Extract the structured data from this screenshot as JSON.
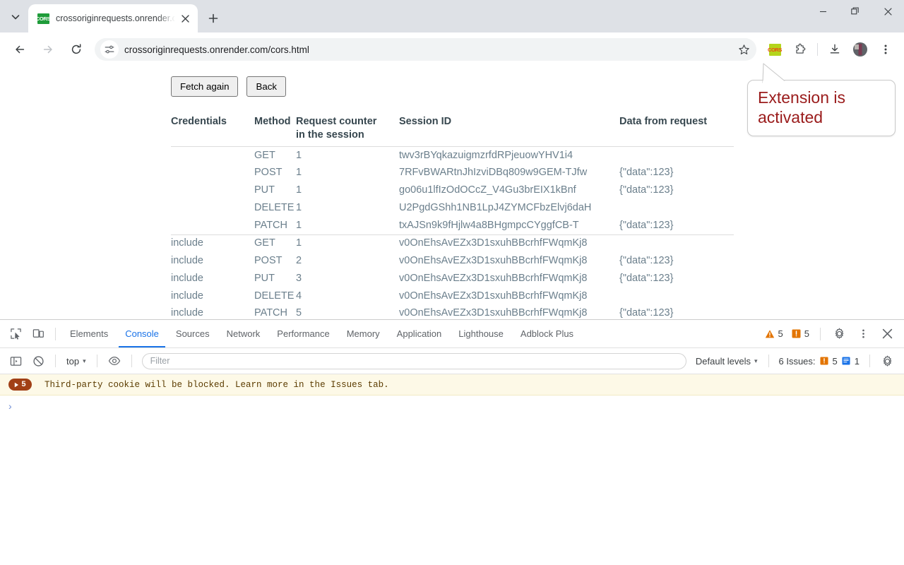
{
  "browser": {
    "tab": {
      "title": "crossoriginrequests.onrender.c",
      "favicon_label": "CORS",
      "favicon_icon": "cors-green-logo",
      "close_icon": "close-icon"
    },
    "tab_search_icon": "chevron-down-icon",
    "new_tab_icon": "plus-icon",
    "window_controls": {
      "minimize_icon": "minimize-icon",
      "maximize_icon": "maximize-restore-icon",
      "close_icon": "close-icon"
    },
    "toolbar": {
      "back_icon": "back-arrow-icon",
      "forward_icon": "forward-arrow-icon",
      "reload_icon": "reload-icon",
      "site_info_icon": "tune-sliders-icon",
      "url": "crossoriginrequests.onrender.com/cors.html",
      "bookmark_icon": "star-icon",
      "extension_cors_label": "CORS",
      "extension_cors_icon": "cors-extension-icon",
      "extensions_puzzle_icon": "puzzle-piece-icon",
      "downloads_icon": "download-icon",
      "profile_icon": "avatar-icon",
      "menu_icon": "three-dots-vertical-icon"
    }
  },
  "callout": {
    "line1": "Extension is",
    "line2": "activated",
    "color": "#9a1b1b"
  },
  "page": {
    "buttons": {
      "fetch_again": "Fetch again",
      "back": "Back"
    },
    "table": {
      "headers": {
        "credentials": "Credentials",
        "method": "Method",
        "counter_line1": "Request counter",
        "counter_line2": "in the session",
        "session_id": "Session ID",
        "data": "Data from request"
      },
      "group1": [
        {
          "credentials": "",
          "method": "GET",
          "counter": "1",
          "session": "twv3rBYqkazuigmzrfdRPjeuowYHV1i4",
          "data": ""
        },
        {
          "credentials": "",
          "method": "POST",
          "counter": "1",
          "session": "7RFvBWARtnJhIzviDBq809w9GEM-TJfw",
          "data": "{\"data\":123}"
        },
        {
          "credentials": "",
          "method": "PUT",
          "counter": "1",
          "session": "go06u1lfIzOdOCcZ_V4Gu3brEIX1kBnf",
          "data": "{\"data\":123}"
        },
        {
          "credentials": "",
          "method": "DELETE",
          "counter": "1",
          "session": "U2PgdGShh1NB1LpJ4ZYMCFbzElvj6daH",
          "data": ""
        },
        {
          "credentials": "",
          "method": "PATCH",
          "counter": "1",
          "session": "txAJSn9k9fHjlw4a8BHgmpcCYggfCB-T",
          "data": "{\"data\":123}"
        }
      ],
      "group2": [
        {
          "credentials": "include",
          "method": "GET",
          "counter": "1",
          "session": "v0OnEhsAvEZx3D1sxuhBBcrhfFWqmKj8",
          "data": ""
        },
        {
          "credentials": "include",
          "method": "POST",
          "counter": "2",
          "session": "v0OnEhsAvEZx3D1sxuhBBcrhfFWqmKj8",
          "data": "{\"data\":123}"
        },
        {
          "credentials": "include",
          "method": "PUT",
          "counter": "3",
          "session": "v0OnEhsAvEZx3D1sxuhBBcrhfFWqmKj8",
          "data": "{\"data\":123}"
        },
        {
          "credentials": "include",
          "method": "DELETE",
          "counter": "4",
          "session": "v0OnEhsAvEZx3D1sxuhBBcrhfFWqmKj8",
          "data": ""
        },
        {
          "credentials": "include",
          "method": "PATCH",
          "counter": "5",
          "session": "v0OnEhsAvEZx3D1sxuhBBcrhfFWqmKj8",
          "data": "{\"data\":123}"
        }
      ]
    }
  },
  "devtools": {
    "inspect_icon": "inspect-element-icon",
    "device_toolbar_icon": "device-toolbar-icon",
    "tabs": [
      {
        "label": "Elements",
        "active": false
      },
      {
        "label": "Console",
        "active": true
      },
      {
        "label": "Sources",
        "active": false
      },
      {
        "label": "Network",
        "active": false
      },
      {
        "label": "Performance",
        "active": false
      },
      {
        "label": "Memory",
        "active": false
      },
      {
        "label": "Application",
        "active": false
      },
      {
        "label": "Lighthouse",
        "active": false
      },
      {
        "label": "Adblock Plus",
        "active": false
      }
    ],
    "warning_count": "5",
    "error_count": "5",
    "warning_icon": "warning-triangle-icon",
    "error_icon": "issue-flag-icon",
    "settings_icon": "gear-icon",
    "more_icon": "three-dots-vertical-icon",
    "close_icon": "close-icon",
    "console_toolbar": {
      "sidebar_toggle_icon": "console-sidebar-toggle-icon",
      "clear_console_icon": "clear-console-icon",
      "context_value": "top",
      "context_caret": "▾",
      "live_expression_icon": "eye-icon",
      "filter_placeholder": "Filter",
      "filter_value": "",
      "levels_value": "Default levels",
      "levels_caret": "▾",
      "issues_label": "6 Issues:",
      "issues_error_count": "5",
      "issues_info_count": "1",
      "settings_icon": "gear-icon"
    },
    "console_messages": [
      {
        "badge_count": "5",
        "badge_icon": "expand-triangle-icon",
        "text": "Third-party cookie will be blocked. Learn more in the Issues tab."
      }
    ],
    "prompt_chevron": "›"
  }
}
